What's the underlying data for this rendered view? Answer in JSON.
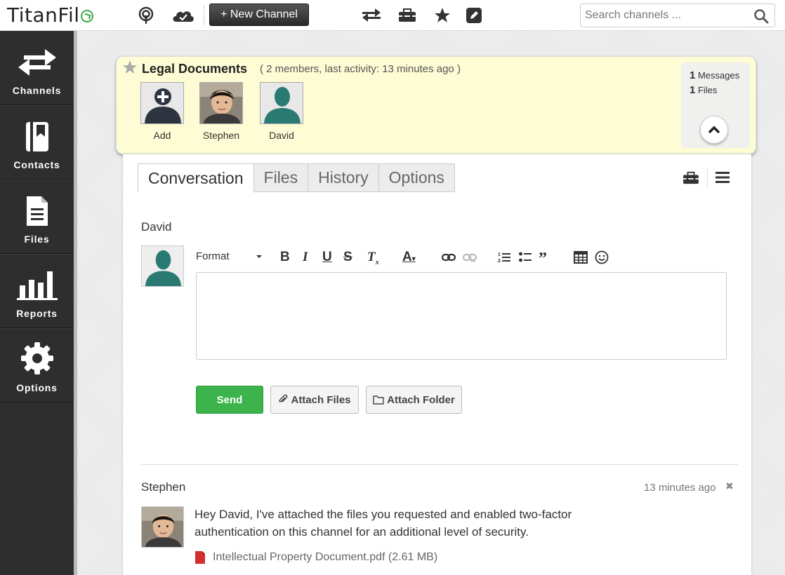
{
  "app": {
    "logo": "TitanFil"
  },
  "toolbar": {
    "new_channel_label": "+ New Channel",
    "search_placeholder": "Search channels ..."
  },
  "sidebar": {
    "items": [
      {
        "label": "Channels",
        "icon": "channels-icon"
      },
      {
        "label": "Contacts",
        "icon": "contacts-icon"
      },
      {
        "label": "Files",
        "icon": "files-icon"
      },
      {
        "label": "Reports",
        "icon": "reports-icon"
      },
      {
        "label": "Options",
        "icon": "gear-icon"
      }
    ]
  },
  "channel": {
    "title": "Legal Documents",
    "meta": "( 2 members, last activity: 13 minutes ago )",
    "members": [
      {
        "name": "Add"
      },
      {
        "name": "Stephen"
      },
      {
        "name": "David"
      }
    ],
    "stats": {
      "messages_count": "1",
      "messages_label": "Messages",
      "files_count": "1",
      "files_label": "Files"
    }
  },
  "tabs": [
    {
      "label": "Conversation",
      "active": true
    },
    {
      "label": "Files",
      "active": false
    },
    {
      "label": "History",
      "active": false
    },
    {
      "label": "Options",
      "active": false
    }
  ],
  "composer": {
    "author": "David",
    "format_label": "Format",
    "send_label": "Send",
    "attach_files_label": "Attach Files",
    "attach_folder_label": "Attach Folder"
  },
  "messages": [
    {
      "author": "Stephen",
      "time": "13 minutes ago",
      "body": "Hey David, I've attached the files you requested and enabled two-factor authentication on this channel for an additional level of security.",
      "attachment": "Intellectual Property Document.pdf (2.61 MB)"
    }
  ],
  "colors": {
    "sidebar_bg": "#2e2e2e",
    "header_bg": "#fdfcd4",
    "send_green": "#3db34b",
    "pdf_red": "#d32f2f",
    "logo_accent": "#3aa84a"
  }
}
